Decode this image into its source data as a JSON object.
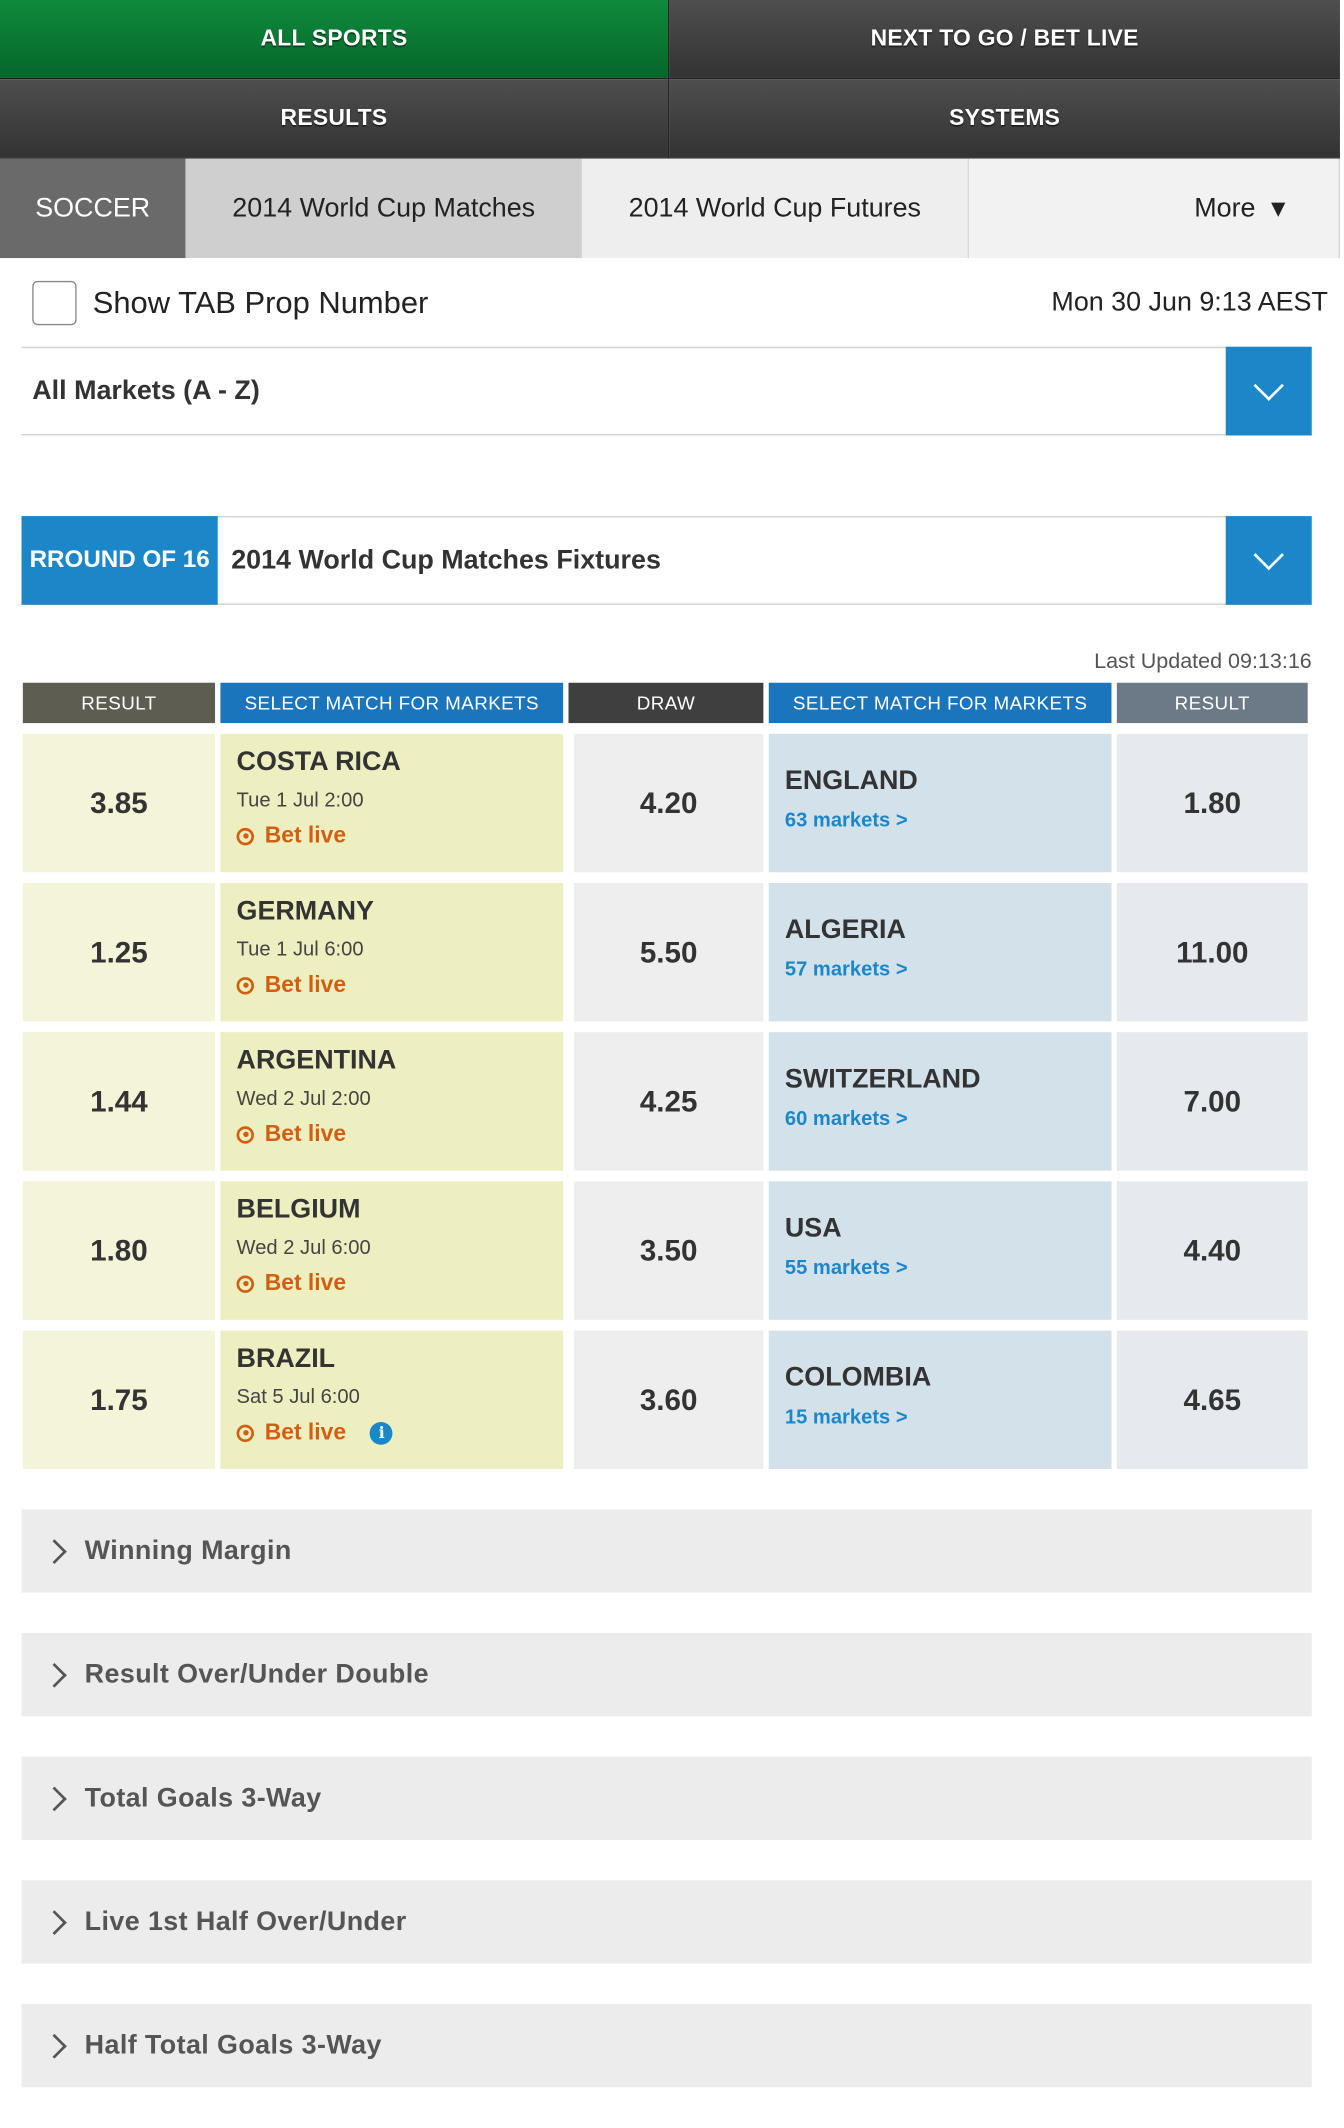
{
  "topnav": {
    "all_sports": "ALL SPORTS",
    "next_to_go": "NEXT TO GO / BET LIVE",
    "results": "RESULTS",
    "systems": "SYSTEMS"
  },
  "sport_tabs": {
    "soccer": "SOCCER",
    "matches": "2014 World Cup Matches",
    "futures": "2014 World Cup Futures",
    "more": "More"
  },
  "prop": {
    "label": "Show TAB Prop Number",
    "checked": false
  },
  "datetime": "Mon 30 Jun 9:13 AEST",
  "markets_select": {
    "value": "All Markets (A - Z)"
  },
  "fixtures_select": {
    "round": "RROUND OF 16",
    "value": "2014 World Cup Matches Fixtures"
  },
  "last_updated": "Last Updated 09:13:16",
  "table": {
    "headers": [
      "RESULT",
      "SELECT MATCH FOR MARKETS",
      "DRAW",
      "SELECT MATCH FOR MARKETS",
      "RESULT"
    ],
    "bet_live_label": "Bet live",
    "rows": [
      {
        "home_odds": "3.85",
        "home": "COSTA RICA",
        "date": "Tue 1 Jul 2:00",
        "draw": "4.20",
        "away": "ENGLAND",
        "markets": "63 markets >",
        "away_odds": "1.80"
      },
      {
        "home_odds": "1.25",
        "home": "GERMANY",
        "date": "Tue 1 Jul 6:00",
        "draw": "5.50",
        "away": "ALGERIA",
        "markets": "57 markets >",
        "away_odds": "11.00"
      },
      {
        "home_odds": "1.44",
        "home": "ARGENTINA",
        "date": "Wed 2 Jul 2:00",
        "draw": "4.25",
        "away": "SWITZERLAND",
        "markets": "60 markets >",
        "away_odds": "7.00"
      },
      {
        "home_odds": "1.80",
        "home": "BELGIUM",
        "date": "Wed 2 Jul 6:00",
        "draw": "3.50",
        "away": "USA",
        "markets": "55 markets >",
        "away_odds": "4.40"
      },
      {
        "home_odds": "1.75",
        "home": "BRAZIL",
        "date": "Sat 5 Jul 6:00",
        "draw": "3.60",
        "away": "COLOMBIA",
        "markets": "15 markets >",
        "away_odds": "4.65",
        "info": "i"
      }
    ]
  },
  "accordions": [
    "Winning Margin",
    "Result Over/Under Double",
    "Total Goals 3-Way",
    "Live 1st Half Over/Under",
    "Half Total Goals 3-Way"
  ],
  "colors": {
    "brand_green": "#0f8a3c",
    "accent_blue": "#1b87c9",
    "bet_live_orange": "#d25f11",
    "nav_dark": "#3d3d3d"
  }
}
